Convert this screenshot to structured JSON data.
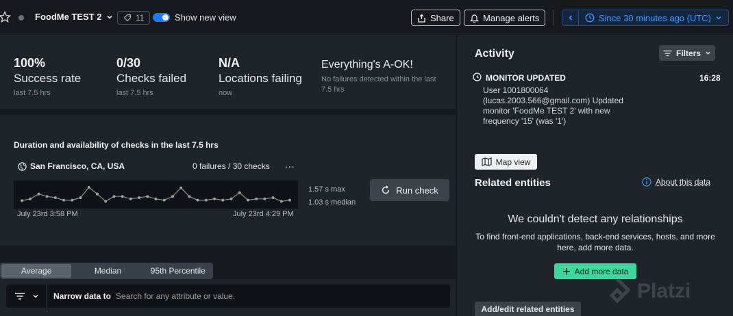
{
  "header": {
    "entity_name": "FoodMe TEST 2",
    "tag_count": "11",
    "toggle_label": "Show new view",
    "share_label": "Share",
    "alerts_label": "Manage alerts",
    "time_range": "Since 30 minutes ago (UTC)"
  },
  "summary": {
    "kpis": [
      {
        "value": "100%",
        "label": "Success rate",
        "sub": "last 7.5 hrs"
      },
      {
        "value": "0/30",
        "label": "Checks failed",
        "sub": "last 7.5 hrs"
      },
      {
        "value": "N/A",
        "label": "Locations failing",
        "sub": "now"
      }
    ],
    "status_title": "Everything's A-OK!",
    "status_sub": "No failures detected within the last 7.5 hrs"
  },
  "checks": {
    "title": "Duration and availability of checks in the last 7.5 hrs",
    "location": "San Francisco, CA, USA",
    "failures": "0 failures / 30 checks",
    "more": "...",
    "time_start": "July 23rd 3:58 PM",
    "time_end": "July 23rd 4:29 PM",
    "max": "1.57 s max",
    "median": "1.03 s median",
    "run_label": "Run check",
    "spark_values": [
      1.03,
      1.1,
      1.3,
      1.2,
      1.15,
      1.05,
      1.05,
      1.15,
      1.57,
      1.3,
      1.0,
      1.2,
      1.2,
      1.1,
      1.15,
      1.2,
      1.1,
      1.05,
      1.2,
      1.55,
      1.2,
      1.05,
      1.05,
      1.1,
      1.05,
      1.1,
      1.35,
      1.05,
      1.1,
      1.1,
      1.15,
      1.0,
      1.05
    ]
  },
  "tabs": [
    "Average",
    "Median",
    "95th Percentile"
  ],
  "filter": {
    "narrow_label": "Narrow data to",
    "placeholder": "Search for any attribute or value."
  },
  "activity": {
    "title": "Activity",
    "filters_label": "Filters",
    "event_title": "MONITOR UPDATED",
    "event_time": "16:28",
    "event_body": "User 1001800064 (lucas.2003.566@gmail.com) Updated monitor 'FoodMe TEST 2' with new frequency '15' (was '1')"
  },
  "related": {
    "map_view": "Map view",
    "title": "Related entities",
    "about": "About this data",
    "empty_title": "We couldn't detect any relationships",
    "empty_sub": "To find front-end applications, back-end services, hosts, and more here, add more data.",
    "add_more": "Add more data",
    "add_edit": "Add/edit related entities"
  },
  "watermark": "Platzi",
  "colors": {
    "accent_blue": "#1d7afc",
    "success_green": "#3dd69b"
  }
}
